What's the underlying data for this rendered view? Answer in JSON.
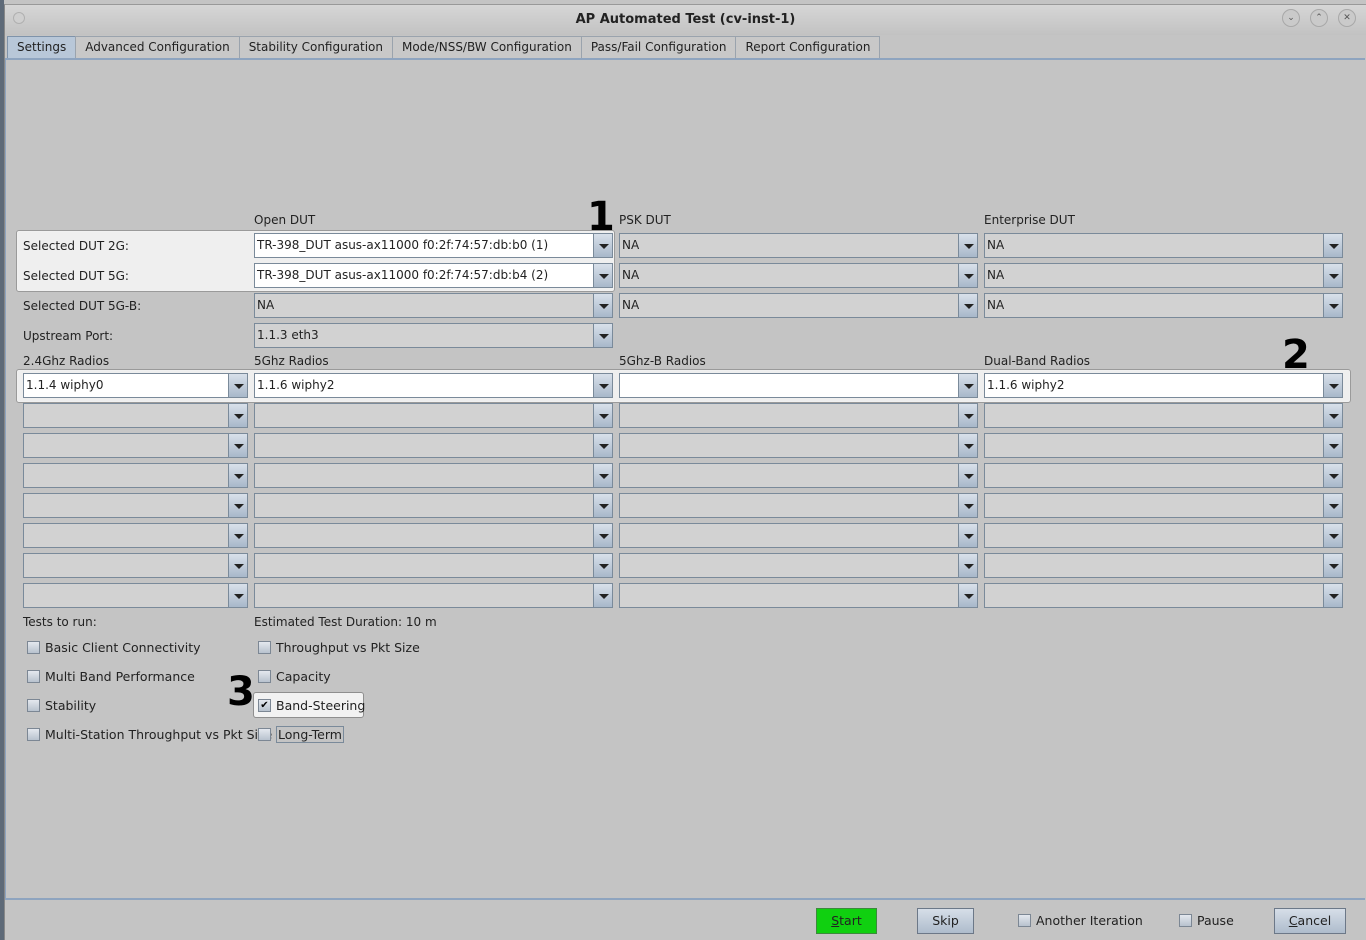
{
  "window": {
    "title": "AP Automated Test  (cv-inst-1)",
    "controls": [
      "minimize-icon",
      "maximize-icon",
      "close-icon"
    ]
  },
  "tabs": [
    {
      "label": "Settings",
      "active": true
    },
    {
      "label": "Advanced Configuration",
      "active": false
    },
    {
      "label": "Stability Configuration",
      "active": false
    },
    {
      "label": "Mode/NSS/BW Configuration",
      "active": false
    },
    {
      "label": "Pass/Fail Configuration",
      "active": false
    },
    {
      "label": "Report Configuration",
      "active": false
    }
  ],
  "dut": {
    "column_headers": {
      "open": "Open DUT",
      "psk": "PSK DUT",
      "enterprise": "Enterprise DUT"
    },
    "rows": [
      {
        "label": "Selected DUT 2G:",
        "open": "TR-398_DUT asus-ax11000 f0:2f:74:57:db:b0 (1)",
        "psk": "NA",
        "enterprise": "NA"
      },
      {
        "label": "Selected DUT 5G:",
        "open": "TR-398_DUT asus-ax11000 f0:2f:74:57:db:b4 (2)",
        "psk": "NA",
        "enterprise": "NA"
      },
      {
        "label": "Selected DUT 5G-B:",
        "open": "NA",
        "psk": "NA",
        "enterprise": "NA"
      }
    ],
    "upstream_label": "Upstream Port:",
    "upstream_value": "1.1.3 eth3"
  },
  "radios": {
    "headers": {
      "r24": "2.4Ghz Radios",
      "r5": "5Ghz Radios",
      "r5b": "5Ghz-B Radios",
      "dual": "Dual-Band Radios"
    },
    "first_row": {
      "r24": "1.1.4 wiphy0",
      "r5": "1.1.6 wiphy2",
      "r5b": "",
      "dual": "1.1.6 wiphy2"
    },
    "empty_rows": 7
  },
  "tests": {
    "label": "Tests to run:",
    "duration": "Estimated Test Duration: 10 m",
    "left": [
      {
        "label": "Basic Client Connectivity",
        "checked": false
      },
      {
        "label": "Multi Band Performance",
        "checked": false
      },
      {
        "label": "Stability",
        "checked": false
      },
      {
        "label": "Multi-Station Throughput vs Pkt Size",
        "checked": false
      }
    ],
    "right": [
      {
        "label": "Throughput vs Pkt Size",
        "checked": false
      },
      {
        "label": "Capacity",
        "checked": false
      },
      {
        "label": "Band-Steering",
        "checked": true
      },
      {
        "label": "Long-Term",
        "checked": false
      }
    ]
  },
  "annotations": [
    "1",
    "2",
    "3"
  ],
  "bottom": {
    "start": {
      "mnemonic": "S",
      "rest": "tart",
      "color": "#10d010"
    },
    "skip": "Skip",
    "another_iteration": {
      "label": "Another Iteration",
      "checked": false
    },
    "pause": {
      "label": "Pause",
      "checked": false
    },
    "cancel": {
      "mnemonic": "C",
      "rest": "ancel"
    }
  }
}
